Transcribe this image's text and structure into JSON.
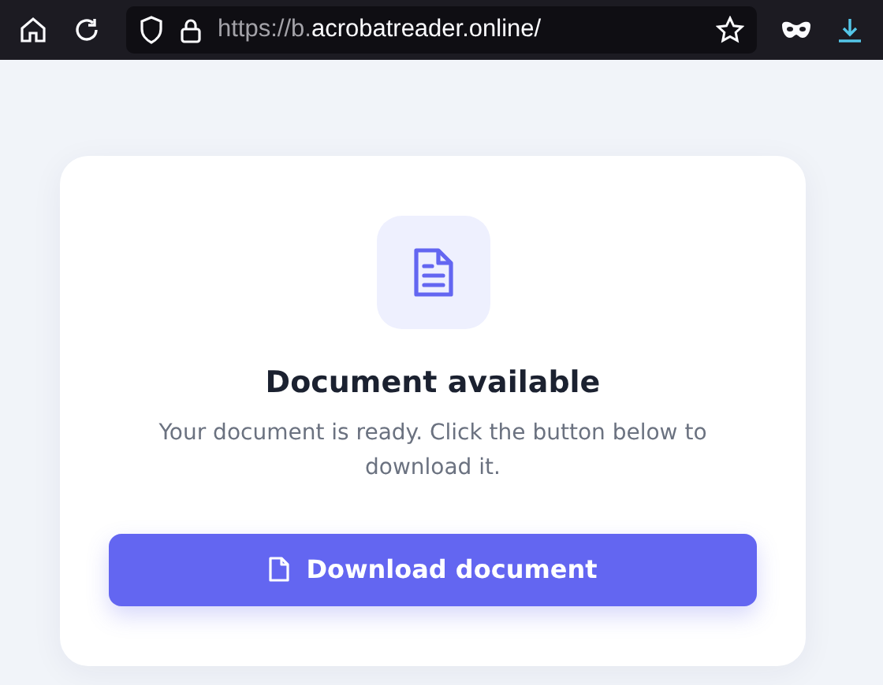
{
  "browser": {
    "address": {
      "dim": "https://b.",
      "bright": "acrobatreader.online/"
    }
  },
  "card": {
    "title": "Document available",
    "message": "Your document is ready. Click the button below to download it.",
    "button": "Download document"
  }
}
